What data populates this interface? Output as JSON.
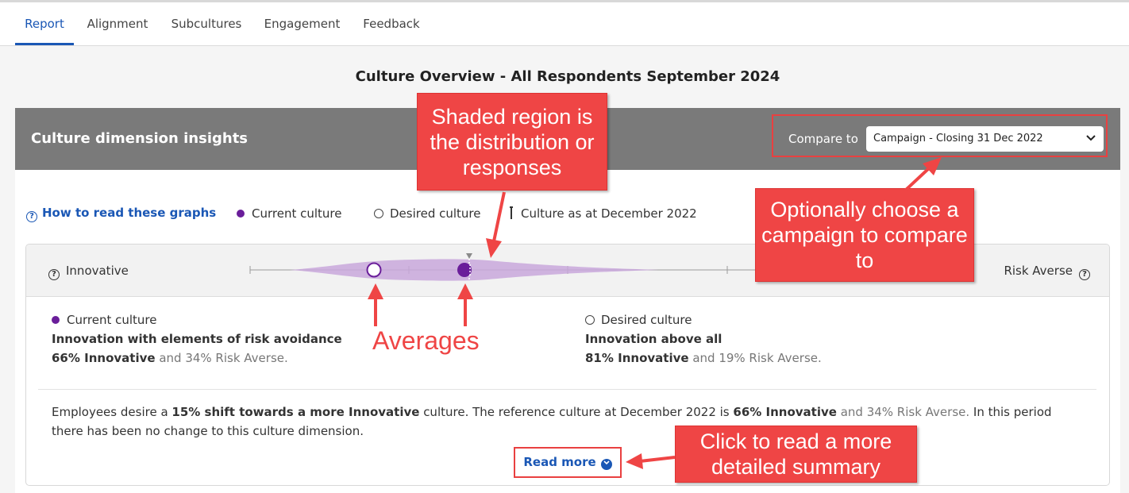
{
  "tabs": [
    {
      "label": "Report",
      "active": true
    },
    {
      "label": "Alignment",
      "active": false
    },
    {
      "label": "Subcultures",
      "active": false
    },
    {
      "label": "Engagement",
      "active": false
    },
    {
      "label": "Feedback",
      "active": false
    }
  ],
  "page_title": "Culture Overview - All Respondents September 2024",
  "insights": {
    "title": "Culture dimension insights",
    "compare_label": "Compare to",
    "compare_value": "Campaign - Closing 31 Dec 2022"
  },
  "legend": {
    "how_to_read": "How to read these graphs",
    "current": "Current culture",
    "desired": "Desired culture",
    "reference": "Culture as at December 2022"
  },
  "dimension": {
    "left_label": "Innovative",
    "right_label": "Risk Averse",
    "current_innovative_pct": 66,
    "desired_innovative_pct": 81,
    "reference_innovative_pct": 66
  },
  "current_summary": {
    "heading": "Current culture",
    "title": "Innovation with elements of risk avoidance",
    "pct_bold": "66% Innovative",
    "pct_rest": "and 34% Risk Averse."
  },
  "desired_summary": {
    "heading": "Desired culture",
    "title": "Innovation above all",
    "pct_bold": "81% Innovative",
    "pct_rest": "and 19% Risk Averse."
  },
  "paragraph": {
    "t1": "Employees desire a ",
    "b1": "15% shift towards a more Innovative",
    "t2": " culture. The reference culture at December 2022 is ",
    "b2": "66% Innovative",
    "m1": " and 34% Risk Averse.",
    "t3": " In this period there has been no change to this culture dimension."
  },
  "read_more": "Read more",
  "annotations": {
    "shaded_region": "Shaded region is the distribution or responses",
    "compare_campaign": "Optionally choose a campaign to compare to",
    "averages": "Averages",
    "read_more_hint": "Click to read a more detailed summary"
  },
  "colors": {
    "accent_blue": "#1a57b5",
    "current_purple": "#6a1e9a",
    "distribution_fill": "#c9a8dc",
    "header_gray": "#7a7a7a",
    "annotation_red": "#ef4545"
  }
}
